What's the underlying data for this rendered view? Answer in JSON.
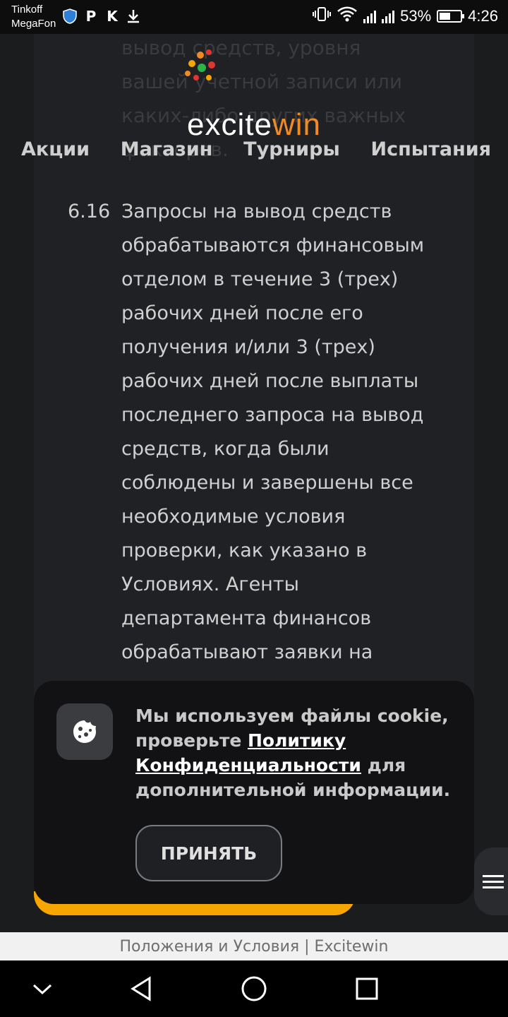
{
  "status_bar": {
    "carrier_line1": "Tinkoff",
    "carrier_line2": "MegaFon",
    "left_icons": [
      "shield-icon",
      "p-app-icon",
      "k-app-icon",
      "download-icon"
    ],
    "battery_percent": "53%",
    "battery_level": 0.53,
    "time": "4:26"
  },
  "header": {
    "logo_prefix": "excite",
    "logo_suffix": "win",
    "nav": [
      "Акции",
      "Магазин",
      "Турниры",
      "Испытания"
    ]
  },
  "content": {
    "ghost_lines": [
      "вывод средств, уровня",
      "вашей учетной записи или",
      "каких-либо других важных",
      "факторов."
    ],
    "clause_number": "6.16",
    "clause_text": "Запросы на вывод средств\nобрабатываются финансовым\nотделом в течение 3 (трех)\nрабочих дней после его\nполучения и/или 3 (трех)\nрабочих дней после выплаты\nпоследнего запроса на вывод\nсредств, когда были\nсоблюдены и завершены все\nнеобходимые условия\nпроверки, как указано в\nУсловиях. Агенты\nдепартамента финансов\nобрабатывают заявки на"
  },
  "cookie": {
    "text_before": "Мы используем файлы cookie, проверьте ",
    "link": "Политику Конфиденциальности",
    "text_after": " для дополнительной информации.",
    "accept_label": "ПРИНЯТЬ"
  },
  "url_bar": {
    "title": "Положения и Условия | Excitewin"
  },
  "colors": {
    "brand_orange": "#f7a600",
    "background": "#1b1c1e"
  }
}
